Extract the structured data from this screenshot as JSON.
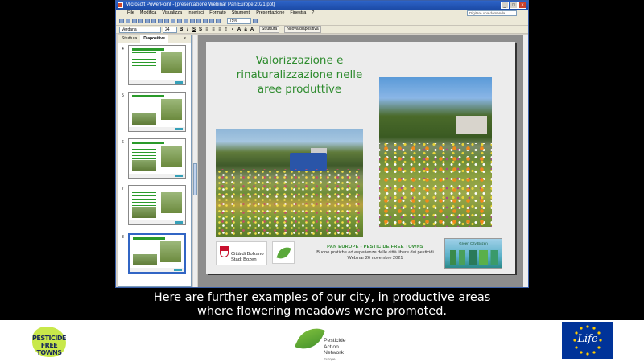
{
  "window": {
    "title": "Microsoft PowerPoint - [presentazione Webinar Pan Europe 2021.ppt]",
    "help_placeholder": "Digitare una domanda",
    "controls": [
      "_",
      "□",
      "×"
    ]
  },
  "menu": [
    "File",
    "Modifica",
    "Visualizza",
    "Inserisci",
    "Formato",
    "Strumenti",
    "Presentazione",
    "Finestra",
    "?"
  ],
  "toolbar": {
    "zoom": "75%",
    "font": "Verdana",
    "font_size": "24",
    "design_button": "Struttura",
    "new_slide_button": "Nuova diapositiva"
  },
  "panel": {
    "tabs": [
      "Struttura",
      "Diapositive"
    ],
    "close": "×",
    "thumbnails": [
      {
        "number": "4"
      },
      {
        "number": "5"
      },
      {
        "number": "6"
      },
      {
        "number": "7"
      },
      {
        "number": "8",
        "selected": true
      }
    ]
  },
  "slide": {
    "title_lines": [
      "Valorizzazione e",
      "rinaturalizzazione nelle",
      "aree produttive"
    ],
    "logo_city": [
      "Città di Bolzano",
      "Stadt Bozen"
    ],
    "event": {
      "line1": "PAN EUROPE - PESTICIDE FREE TOWNS",
      "line2": "Buone pratiche ed esperienze delle città libere dai pesticidi",
      "line3": "Webinar 26 novembre 2021"
    },
    "green_city_label": "Green City Bozen"
  },
  "subtitle": {
    "line1": "Here are further examples of our city, in productive areas",
    "line2": "where flowering meadows were promoted."
  },
  "footer": {
    "pft_logo": [
      "PESTICIDE",
      "FREE TOWNS"
    ],
    "pan_logo": [
      "Pesticide",
      "Action",
      "Network",
      "Europe"
    ],
    "life_logo": "Life"
  },
  "colors": {
    "title_green": "#2e8b2e",
    "eu_blue": "#003399",
    "pft_lime": "#c8e84a"
  }
}
